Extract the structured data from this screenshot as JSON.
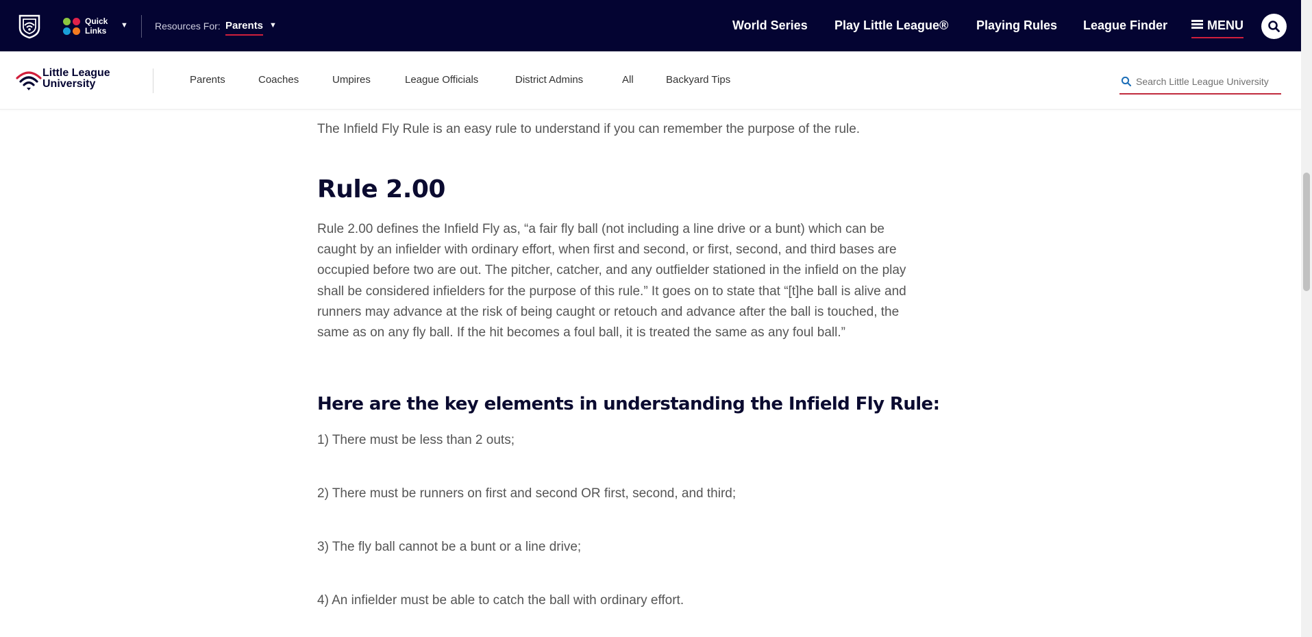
{
  "topbar": {
    "quick_links": "Quick Links",
    "resources_label": "Resources For:",
    "resources_value": "Parents",
    "nav": [
      "World Series",
      "Play Little League®",
      "Playing Rules",
      "League Finder"
    ],
    "menu_label": "MENU",
    "colors": {
      "background": "#040432",
      "accent": "#d11f3c"
    },
    "quick_link_dots": [
      "#8cc63f",
      "#e0224a",
      "#19a0d8",
      "#f47b20"
    ]
  },
  "subnav": {
    "brand_line1": "Little League",
    "brand_line2": "University",
    "items": [
      "Parents",
      "Coaches",
      "Umpires",
      "League Officials",
      "District Admins",
      "All",
      "Backyard Tips"
    ],
    "search_placeholder": "Search Little League University"
  },
  "article": {
    "intro": "The Infield Fly Rule is an easy rule to understand if you can remember the purpose of the rule.",
    "rule_heading": "Rule 2.00",
    "rule_text": "Rule 2.00 defines the Infield Fly as, “a fair fly ball (not including a line drive or a bunt) which can be caught by an infielder with ordinary effort, when first and second, or first, second, and third bases are occupied before two are out. The pitcher, catcher, and any outfielder stationed in the infield on the play shall be considered infielders for the purpose of this rule.” It goes on to state that “[t]he ball is alive and runners may advance at the risk of being caught or retouch and advance after the ball is touched, the same as on any fly ball. If the hit becomes a foul ball, it is treated the same as any foul ball.”",
    "key_heading": "Here are the key elements in understanding the Infield Fly Rule:",
    "key_items": [
      "1) There must be less than 2 outs;",
      "2) There must be runners on first and second OR first, second, and third;",
      "3) The fly ball cannot be a bunt or a line drive;",
      "4) An infielder must be able to catch the ball with ordinary effort."
    ]
  }
}
